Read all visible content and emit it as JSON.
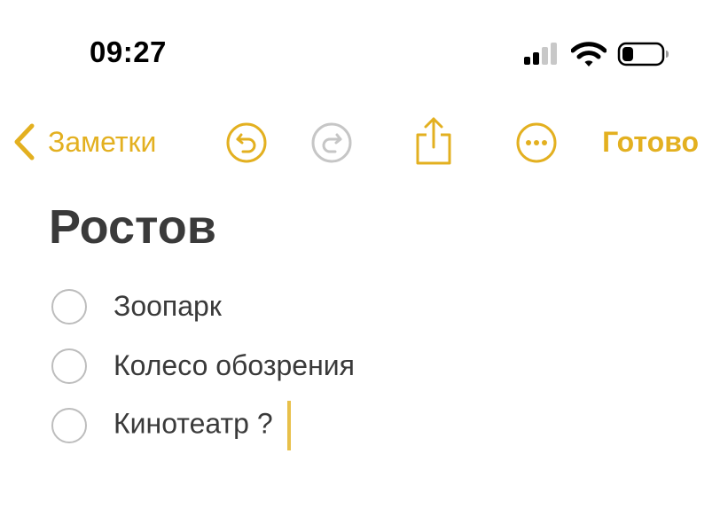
{
  "status_bar": {
    "time": "09:27"
  },
  "toolbar": {
    "back_label": "Заметки",
    "done_label": "Готово",
    "icons": [
      "chevron-left-icon",
      "undo-icon",
      "redo-icon",
      "share-icon",
      "more-icon"
    ]
  },
  "note": {
    "title": "Ростов",
    "items": [
      {
        "text": "Зоопарк",
        "checked": false
      },
      {
        "text": "Колесо обозрения",
        "checked": false
      },
      {
        "text": "Кинотеатр ?",
        "checked": false
      }
    ]
  },
  "colors": {
    "accent": "#e3b020",
    "text": "#3a3a3a",
    "disabled": "#bdbdbd",
    "caret": "#e8c04a"
  }
}
